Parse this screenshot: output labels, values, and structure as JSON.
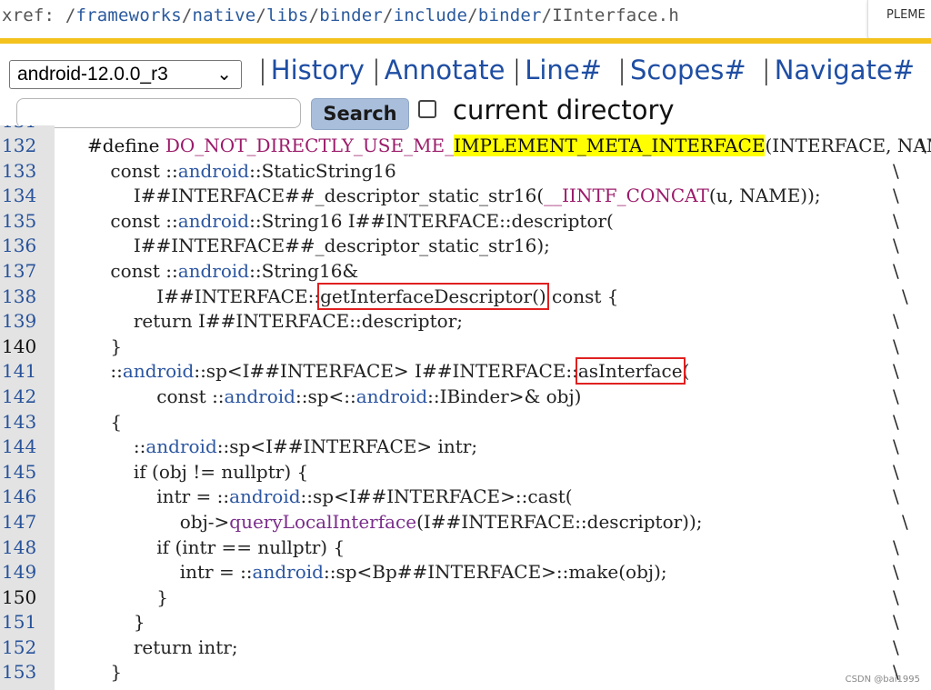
{
  "xref": {
    "prefix": "xref: /",
    "segments": [
      "frameworks",
      "native",
      "libs",
      "binder",
      "include",
      "binder",
      "IInterface.h"
    ],
    "corner_text": "PLEME"
  },
  "nav": {
    "version": "android-12.0.0_r3",
    "links": [
      "History",
      "Annotate",
      "Line#",
      "Scopes#",
      "Navigate#"
    ]
  },
  "search": {
    "placeholder": "",
    "button_label": "Search",
    "checkbox_label": "current directory",
    "checkbox_checked": false
  },
  "code": {
    "partial_top_line": "131",
    "lines": [
      {
        "n": "132",
        "t": "#define DO_NOT_DIRECTLY_USE_ME_IMPLEMENT_META_INTERFACE(INTERFACE, NAME)\\"
      },
      {
        "n": "133",
        "t": "    const ::android::StaticString16                                       \\"
      },
      {
        "n": "134",
        "t": "        I##INTERFACE##_descriptor_static_str16(__IINTF_CONCAT(u, NAME));\\"
      },
      {
        "n": "135",
        "t": "    const ::android::String16 I##INTERFACE::descriptor(                   \\"
      },
      {
        "n": "136",
        "t": "        I##INTERFACE##_descriptor_static_str16);                          \\"
      },
      {
        "n": "137",
        "t": "    const ::android::String16&                                            \\"
      },
      {
        "n": "138",
        "t": "            I##INTERFACE::getInterfaceDescriptor() const {                 \\"
      },
      {
        "n": "139",
        "t": "        return I##INTERFACE::descriptor;                                  \\"
      },
      {
        "n": "140",
        "t": "    }                                                                     \\"
      },
      {
        "n": "141",
        "t": "    ::android::sp<I##INTERFACE> I##INTERFACE::asInterface(                \\"
      },
      {
        "n": "142",
        "t": "            const ::android::sp<::android::IBinder>& obj)                 \\"
      },
      {
        "n": "143",
        "t": "    {                                                                     \\"
      },
      {
        "n": "144",
        "t": "        ::android::sp<I##INTERFACE> intr;                                 \\"
      },
      {
        "n": "145",
        "t": "        if (obj != nullptr) {                                             \\"
      },
      {
        "n": "146",
        "t": "            intr = ::android::sp<I##INTERFACE>::cast(                     \\"
      },
      {
        "n": "147",
        "t": "                obj->queryLocalInterface(I##INTERFACE::descriptor));      \\"
      },
      {
        "n": "148",
        "t": "            if (intr == nullptr) {                                        \\"
      },
      {
        "n": "149",
        "t": "                intr = ::android::sp<Bp##INTERFACE>::make(obj);           \\"
      },
      {
        "n": "150",
        "t": "            }                                                             \\"
      },
      {
        "n": "151",
        "t": "        }                                                                 \\"
      },
      {
        "n": "152",
        "t": "        return intr;                                                      \\"
      },
      {
        "n": "153",
        "t": "    }                                                                     \\"
      }
    ],
    "highlight_term": "IMPLEMENT_META_INTERFACE",
    "boxed_terms": [
      "getInterfaceDescriptor()",
      "asInterface"
    ]
  },
  "watermark": "CSDN @bai1995"
}
